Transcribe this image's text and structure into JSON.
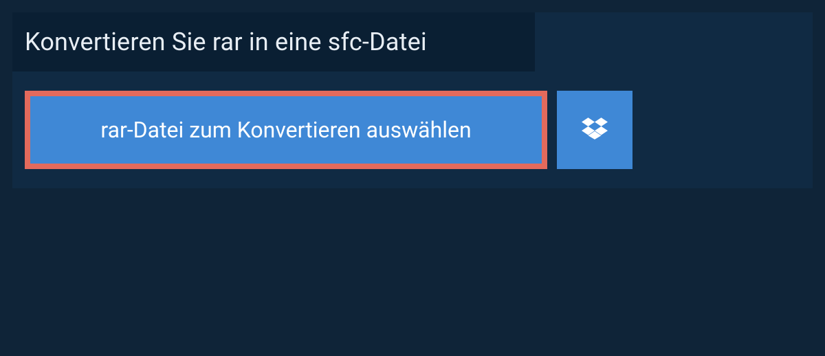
{
  "header": {
    "title": "Konvertieren Sie rar in eine sfc-Datei"
  },
  "actions": {
    "select_file_label": "rar-Datei zum Konvertieren auswählen",
    "dropbox_icon": "dropbox"
  },
  "colors": {
    "background": "#0f2438",
    "panel": "#102a43",
    "header_bg": "#0a1f33",
    "button_bg": "#3f88d6",
    "button_border": "#e36a5c",
    "text_primary": "#e8eef4",
    "text_button": "#ffffff"
  }
}
